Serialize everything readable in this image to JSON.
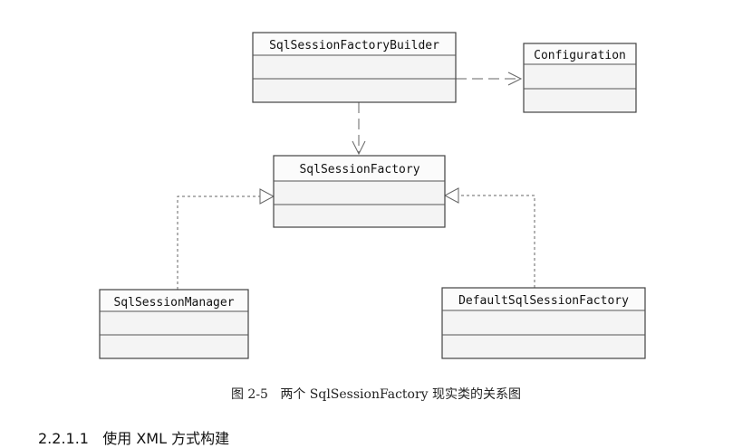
{
  "diagram": {
    "classes": {
      "builder": "SqlSessionFactoryBuilder",
      "configuration": "Configuration",
      "factory": "SqlSessionFactory",
      "manager": "SqlSessionManager",
      "default_factory": "DefaultSqlSessionFactory"
    },
    "relations": [
      {
        "from": "SqlSessionFactoryBuilder",
        "to": "Configuration",
        "type": "dependency"
      },
      {
        "from": "SqlSessionFactoryBuilder",
        "to": "SqlSessionFactory",
        "type": "dependency"
      },
      {
        "from": "SqlSessionManager",
        "to": "SqlSessionFactory",
        "type": "realization"
      },
      {
        "from": "DefaultSqlSessionFactory",
        "to": "SqlSessionFactory",
        "type": "realization"
      }
    ]
  },
  "caption": "图 2-5   两个 SqlSessionFactory 现实类的关系图",
  "section_heading": "2.2.1.1   使用 XML 方式构建"
}
